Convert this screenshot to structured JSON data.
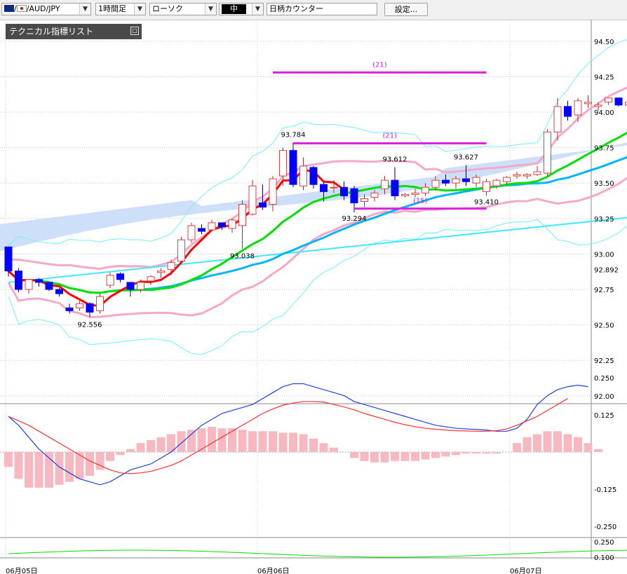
{
  "toolbar": {
    "symbol": "AUD/JPY",
    "timeframe": "1時間足",
    "chart_type": "ローソク",
    "size": "中",
    "counter_label": "日柄カウンター",
    "settings_button": "設定..."
  },
  "tech_list": {
    "label": "テクニカル指標リスト",
    "close": "□"
  },
  "colors": {
    "bull_candle": "#e04040",
    "bear_candle": "#0000ff",
    "ichimoku_cloud": "#c8dcf8",
    "ma_fast": "#ff0000",
    "ma_green": "#00e000",
    "ma_blue": "#00b4ff",
    "ma_cyan": "#40e8ff",
    "bb_pink": "#f7a8c8",
    "bb_cyan": "#70f0ff",
    "macd": "#2040e0",
    "signal": "#ff3030",
    "histogram": "#f8b8c0",
    "counter": "#e020e0"
  },
  "chart_data": [
    {
      "type": "candlestick",
      "ylim": [
        92.0,
        94.58
      ],
      "y_ticks": [
        "94.50",
        "94.25",
        "94.00",
        "93.75",
        "93.50",
        "93.25",
        "93.00",
        "92.75",
        "92.50",
        "92.25",
        "92.00"
      ],
      "current_price": "92.892",
      "x_labels": [
        "06月05日",
        "06月06日",
        "06月07日"
      ],
      "candles": [
        [
          93.05,
          93.03,
          92.88,
          92.84
        ],
        [
          92.88,
          92.9,
          92.75,
          92.73
        ],
        [
          92.75,
          92.82,
          92.82,
          92.72
        ],
        [
          92.82,
          92.83,
          92.8,
          92.77
        ],
        [
          92.8,
          92.8,
          92.75,
          92.74
        ],
        [
          92.75,
          92.76,
          92.72,
          92.7
        ],
        [
          92.62,
          92.65,
          92.6,
          92.58
        ],
        [
          92.62,
          92.67,
          92.65,
          92.6
        ],
        [
          92.65,
          92.66,
          92.59,
          92.556
        ],
        [
          92.6,
          92.72,
          92.7,
          92.58
        ],
        [
          92.78,
          92.87,
          92.85,
          92.76
        ],
        [
          92.86,
          92.87,
          92.82,
          92.8
        ],
        [
          92.8,
          92.79,
          92.75,
          92.7
        ],
        [
          92.75,
          92.82,
          92.8,
          92.73
        ],
        [
          92.81,
          92.85,
          92.84,
          92.78
        ],
        [
          92.87,
          92.9,
          92.88,
          92.83
        ],
        [
          92.89,
          92.96,
          92.94,
          92.85
        ],
        [
          92.95,
          93.12,
          93.1,
          92.93
        ],
        [
          93.1,
          93.22,
          93.2,
          93.08
        ],
        [
          93.18,
          93.21,
          93.16,
          93.14
        ],
        [
          93.17,
          93.24,
          93.22,
          93.16
        ],
        [
          93.22,
          93.22,
          93.19,
          93.17
        ],
        [
          93.18,
          93.25,
          93.24,
          93.15
        ],
        [
          93.2,
          93.38,
          93.35,
          93.038
        ],
        [
          93.28,
          93.52,
          93.48,
          93.27
        ],
        [
          93.36,
          93.49,
          93.33,
          93.31
        ],
        [
          93.35,
          93.55,
          93.53,
          93.3
        ],
        [
          93.55,
          93.75,
          93.73,
          93.48
        ],
        [
          93.73,
          93.784,
          93.49,
          93.47
        ],
        [
          93.48,
          93.68,
          93.62,
          93.45
        ],
        [
          93.61,
          93.62,
          93.49,
          93.46
        ],
        [
          93.49,
          93.51,
          93.44,
          93.37
        ],
        [
          93.47,
          93.52,
          93.47,
          93.43
        ],
        [
          93.47,
          93.51,
          93.41,
          93.38
        ],
        [
          93.46,
          93.48,
          93.36,
          93.294
        ],
        [
          93.37,
          93.42,
          93.39,
          93.33
        ],
        [
          93.4,
          93.45,
          93.43,
          93.37
        ],
        [
          93.46,
          93.55,
          93.52,
          93.42
        ],
        [
          93.52,
          93.612,
          93.41,
          93.38
        ],
        [
          93.41,
          93.43,
          93.42,
          93.4
        ],
        [
          93.42,
          93.46,
          93.43,
          93.4
        ],
        [
          93.43,
          93.5,
          93.47,
          93.41
        ],
        [
          93.47,
          93.55,
          93.52,
          93.45
        ],
        [
          93.52,
          93.56,
          93.5,
          93.48
        ],
        [
          93.5,
          93.55,
          93.53,
          93.46
        ],
        [
          93.53,
          93.627,
          93.51,
          93.48
        ],
        [
          93.5,
          93.56,
          93.54,
          93.47
        ],
        [
          93.44,
          93.53,
          93.51,
          93.41
        ],
        [
          93.48,
          93.53,
          93.52,
          93.46
        ],
        [
          93.51,
          93.55,
          93.54,
          93.49
        ],
        [
          93.55,
          93.58,
          93.56,
          93.53
        ],
        [
          93.55,
          93.57,
          93.56,
          93.53
        ],
        [
          93.56,
          93.62,
          93.58,
          93.55
        ],
        [
          93.57,
          93.88,
          93.86,
          93.55
        ],
        [
          93.86,
          94.1,
          94.04,
          93.8
        ],
        [
          94.04,
          94.08,
          93.97,
          93.94
        ],
        [
          93.98,
          94.1,
          94.08,
          93.93
        ],
        [
          94.06,
          94.12,
          94.07,
          94.03
        ],
        [
          94.04,
          94.07,
          94.05,
          94.01
        ],
        [
          94.07,
          94.1,
          94.1,
          94.05
        ],
        [
          94.1,
          94.09,
          94.05,
          94.04
        ],
        [
          94.05,
          94.12,
          94.07,
          94.03
        ]
      ],
      "annotations": {
        "high_low_labels": [
          "93.784",
          "93.612",
          "93.627",
          "93.294",
          "93.410",
          "93.038",
          "92.556"
        ],
        "counter_labels": [
          "(21)",
          "(21)",
          "(15)"
        ]
      }
    },
    {
      "type": "macd",
      "ylim": [
        -0.27,
        0.26
      ],
      "y_ticks": [
        "0.250",
        "0.125",
        "-0.125",
        "-0.250"
      ],
      "macd": [
        0.12,
        0.09,
        0.05,
        0.01,
        -0.02,
        -0.05,
        -0.07,
        -0.09,
        -0.1,
        -0.11,
        -0.1,
        -0.08,
        -0.06,
        -0.05,
        -0.04,
        -0.02,
        0.0,
        0.03,
        0.06,
        0.09,
        0.11,
        0.13,
        0.14,
        0.15,
        0.16,
        0.18,
        0.2,
        0.22,
        0.23,
        0.23,
        0.22,
        0.21,
        0.2,
        0.19,
        0.17,
        0.16,
        0.15,
        0.14,
        0.13,
        0.12,
        0.11,
        0.1,
        0.09,
        0.085,
        0.08,
        0.078,
        0.076,
        0.074,
        0.07,
        0.07,
        0.08,
        0.11,
        0.16,
        0.19,
        0.21,
        0.22,
        0.225,
        0.22
      ],
      "signal": [
        0.12,
        0.105,
        0.09,
        0.07,
        0.05,
        0.03,
        0.01,
        -0.01,
        -0.03,
        -0.045,
        -0.06,
        -0.07,
        -0.073,
        -0.07,
        -0.065,
        -0.055,
        -0.045,
        -0.03,
        -0.01,
        0.01,
        0.03,
        0.05,
        0.07,
        0.09,
        0.11,
        0.13,
        0.145,
        0.158,
        0.165,
        0.17,
        0.17,
        0.168,
        0.16,
        0.152,
        0.142,
        0.13,
        0.12,
        0.11,
        0.1,
        0.092,
        0.085,
        0.08,
        0.077,
        0.074,
        0.072,
        0.071,
        0.07,
        0.07,
        0.072,
        0.078,
        0.09,
        0.105,
        0.12,
        0.14,
        0.16,
        0.18
      ],
      "histogram": [
        -0.05,
        -0.09,
        -0.12,
        -0.12,
        -0.12,
        -0.11,
        -0.1,
        -0.09,
        -0.08,
        -0.06,
        -0.03,
        -0.01,
        0.01,
        0.03,
        0.04,
        0.05,
        0.06,
        0.07,
        0.075,
        0.08,
        0.085,
        0.08,
        0.08,
        0.075,
        0.07,
        0.07,
        0.07,
        0.065,
        0.065,
        0.06,
        0.045,
        0.03,
        0.015,
        0.0,
        -0.02,
        -0.03,
        -0.035,
        -0.035,
        -0.03,
        -0.03,
        -0.03,
        -0.025,
        -0.02,
        -0.015,
        -0.01,
        -0.005,
        -0.005,
        -0.005,
        -0.005,
        0.0,
        0.03,
        0.05,
        0.06,
        0.07,
        0.07,
        0.06,
        0.05,
        0.03,
        0.01
      ]
    },
    {
      "type": "line",
      "y_ticks": [
        "0.250",
        "0.100"
      ]
    }
  ]
}
